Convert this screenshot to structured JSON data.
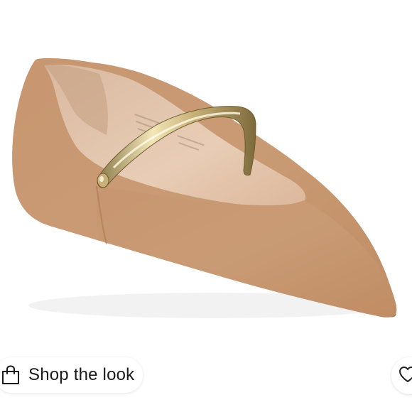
{
  "listing": {
    "image_subject": "shoe-photo"
  },
  "shop_button": {
    "label": "Shop the look",
    "icon": "shopping-bag-icon"
  },
  "like_button": {
    "icon": "heart-icon"
  },
  "colors": {
    "suede": "#c99a72",
    "gold_strap": "#d8c48a",
    "background": "#ffffff"
  }
}
